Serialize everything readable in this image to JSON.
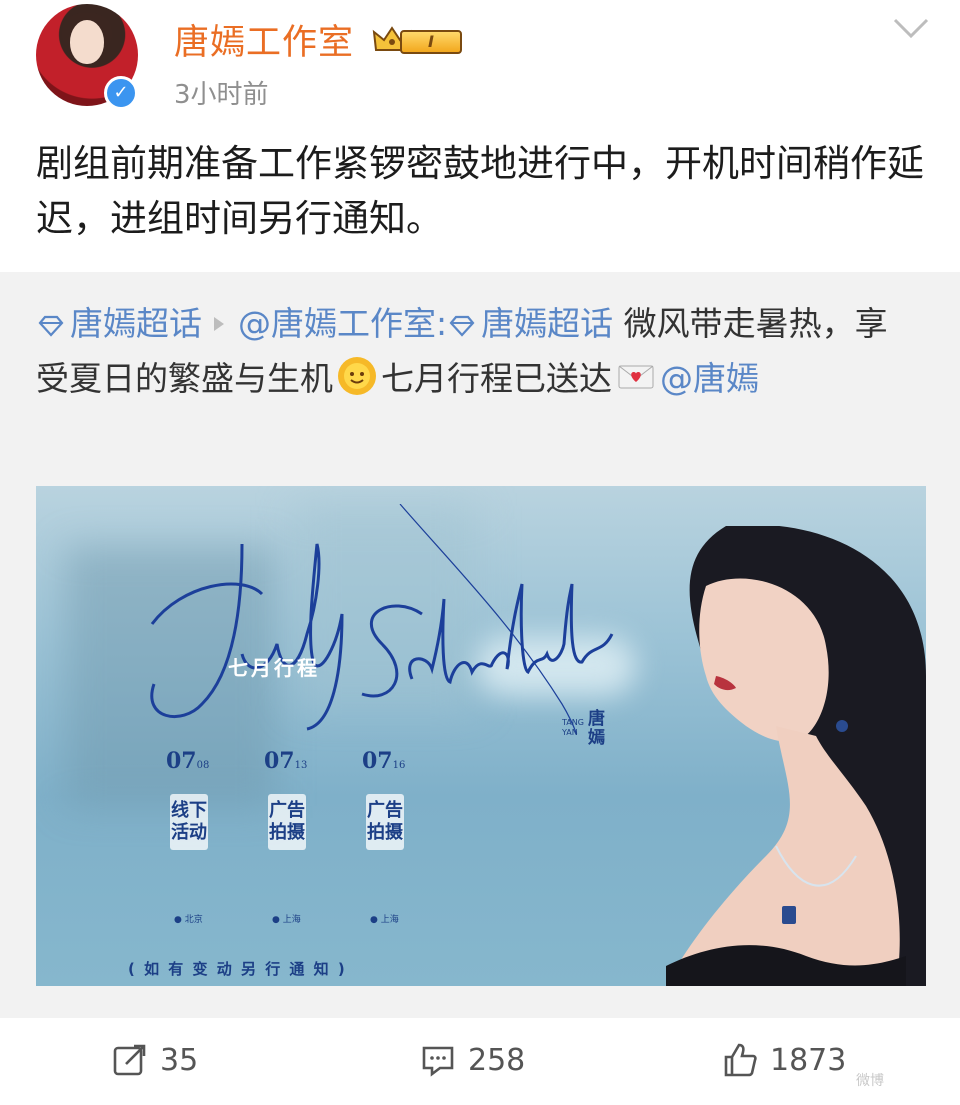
{
  "author": {
    "name": "唐嫣工作室",
    "time": "3小时前",
    "vip_level": "I"
  },
  "post": {
    "text": "剧组前期准备工作紧锣密鼓地进行中，开机时间稍作延迟，进组时间另行通知。"
  },
  "repost": {
    "topic_tag": "唐嫣超话",
    "mention_author": "@唐嫣工作室:",
    "topic_tag_2": "唐嫣超话",
    "text_1": " 微风带走暑热，享受夏日的繁盛与生机",
    "text_2": "七月行程已送达",
    "mention_end": "@唐嫣"
  },
  "poster": {
    "subtitle": "七月行程",
    "name_cn": "唐嫣",
    "name_en": "TANG YAN",
    "dates": [
      {
        "month": "07",
        "day": "08",
        "event": "线下活动",
        "location": "● 北京"
      },
      {
        "month": "07",
        "day": "13",
        "event": "广告拍摄",
        "location": "● 上海"
      },
      {
        "month": "07",
        "day": "16",
        "event": "广告拍摄",
        "location": "● 上海"
      }
    ],
    "notice": "(  如 有 变 动    另 行 通 知  )"
  },
  "actions": {
    "repost_count": "35",
    "comment_count": "258",
    "like_count": "1873"
  },
  "watermark": "微博"
}
